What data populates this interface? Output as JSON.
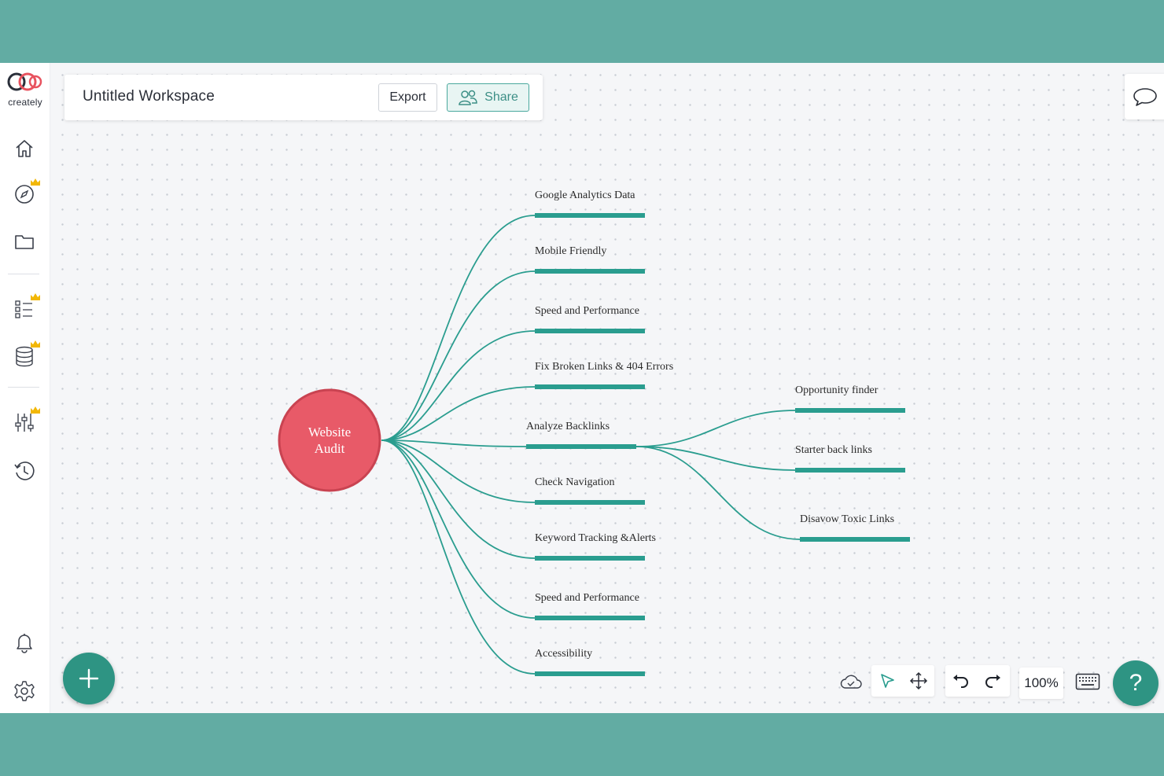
{
  "app": {
    "brand": "creately"
  },
  "header": {
    "workspace_title": "Untitled Workspace",
    "export_label": "Export",
    "share_label": "Share"
  },
  "sidebar": {
    "items": [
      {
        "icon": "home-icon",
        "premium": false
      },
      {
        "icon": "compass-icon",
        "premium": true
      },
      {
        "icon": "folder-icon",
        "premium": false
      },
      {
        "icon": "checklist-icon",
        "premium": true
      },
      {
        "icon": "database-icon",
        "premium": true
      },
      {
        "icon": "sliders-icon",
        "premium": true
      },
      {
        "icon": "history-icon",
        "premium": false
      },
      {
        "icon": "bell-icon",
        "premium": false
      },
      {
        "icon": "gear-icon",
        "premium": false
      }
    ]
  },
  "mindmap": {
    "root": "Website Audit",
    "root_lines": [
      "Website",
      "Audit"
    ],
    "branches": [
      "Google Analytics Data",
      "Mobile Friendly",
      "Speed and Performance",
      "Fix Broken Links & 404 Errors",
      "Analyze Backlinks",
      "Check Navigation",
      "Keyword Tracking &Alerts",
      "Speed and Performance",
      "Accessibility"
    ],
    "sub_branches": [
      "Opportunity finder",
      "Starter back links",
      "Disavow Toxic Links"
    ]
  },
  "toolbar": {
    "zoom": "100%",
    "help": "?"
  },
  "colors": {
    "teal": "#2a9d8f",
    "root_fill": "#e85a68",
    "root_stroke": "#c94351",
    "accent": "#2e9483",
    "frame": "#62aca3"
  }
}
